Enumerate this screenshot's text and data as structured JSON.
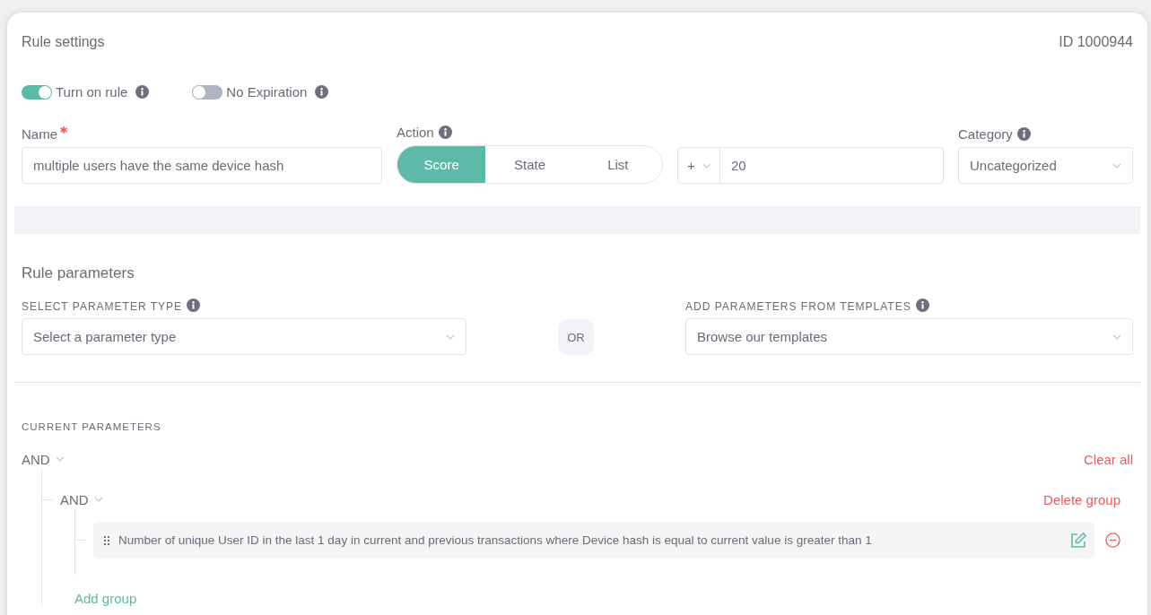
{
  "header": {
    "title": "Rule settings",
    "id": "ID 1000944"
  },
  "toggles": [
    {
      "label": "Turn on rule",
      "on": true
    },
    {
      "label": "No Expiration",
      "on": false
    }
  ],
  "name_field": {
    "label": "Name",
    "required": true,
    "value": "multiple users have the same device hash"
  },
  "action": {
    "label": "Action",
    "options": [
      {
        "label": "Score",
        "selected": true
      },
      {
        "label": "State",
        "selected": false
      },
      {
        "label": "List",
        "selected": false
      }
    ]
  },
  "score": {
    "operator": "+",
    "value": "20"
  },
  "category": {
    "label": "Category",
    "value": "Uncategorized"
  },
  "parameters": {
    "title": "Rule parameters",
    "type_select": {
      "label": "SELECT PARAMETER TYPE",
      "placeholder": "Select a parameter type"
    },
    "or": "OR",
    "templates": {
      "label": "ADD PARAMETERS FROM TEMPLATES",
      "placeholder": "Browse our templates"
    }
  },
  "current": {
    "label": "CURRENT PARAMETERS",
    "root": {
      "operator": "AND",
      "clear": "Clear all",
      "add_group": "Add group",
      "groups": [
        {
          "operator": "AND",
          "delete": "Delete group",
          "conditions": [
            {
              "text": "Number of unique User ID in the last 1 day in current and previous transactions where Device hash is equal to current value is greater than 1"
            }
          ]
        }
      ]
    }
  }
}
